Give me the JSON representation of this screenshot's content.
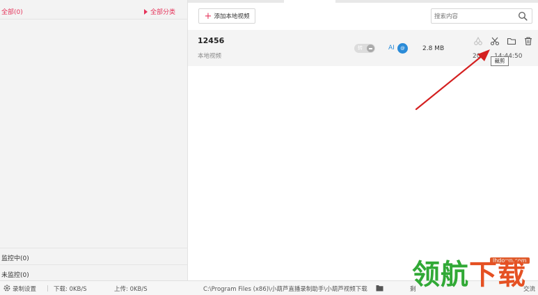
{
  "sidebar": {
    "all_label": "全部(0)",
    "category_button": "全部分类",
    "monitoring_label": "监控中(0)",
    "not_monitoring_label": "未监控(0)"
  },
  "toolbar": {
    "add_button": "添加本地视频",
    "search_placeholder": "搜索内容"
  },
  "video": {
    "title": "12456",
    "subtitle": "本地视频",
    "toggle_text": "转",
    "ai_label": "AI",
    "ai_badge": "@",
    "size": "2.8 MB",
    "time_prefix": "20",
    "time_suffix": "14:44:50"
  },
  "tooltip": "裁剪",
  "statusbar": {
    "settings": "录制设置",
    "download": "下载: 0KB/S",
    "upload": "上传: 0KB/S",
    "path": "C:\\Program Files (x86)\\小葫芦直播录制助手\\小葫芦视频下载",
    "partial_left": "剩",
    "partial_right": "交流"
  },
  "watermark": {
    "url": "lhdown.com",
    "text_green": "领航",
    "text_red": "下载"
  },
  "colors": {
    "accent": "#e5335a",
    "ai_blue": "#2a8bd8",
    "annotation_red": "#d42020"
  }
}
